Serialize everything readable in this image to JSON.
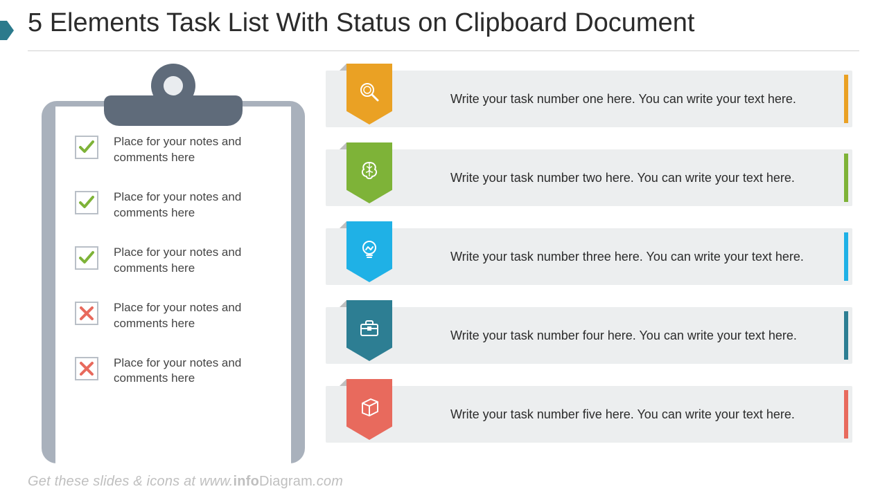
{
  "title": "5 Elements Task List With Status on Clipboard Document",
  "colors": {
    "orange": "#eaa124",
    "green": "#7eb338",
    "blue": "#1fb1e6",
    "teal": "#2d7e93",
    "red": "#e86a5d",
    "check_ok": "#7eb338",
    "check_no": "#e86a5d"
  },
  "clipboard": {
    "items": [
      {
        "status": "ok",
        "text": "Place for your notes and comments  here"
      },
      {
        "status": "ok",
        "text": "Place for your notes and comments  here"
      },
      {
        "status": "ok",
        "text": "Place for your notes and comments  here"
      },
      {
        "status": "no",
        "text": "Place for your notes and comments  here"
      },
      {
        "status": "no",
        "text": "Place for your notes and comments  here"
      }
    ]
  },
  "tasks": [
    {
      "icon": "magnifier-icon",
      "color": "orange",
      "text": "Write your task number one here. You can write your text here."
    },
    {
      "icon": "brain-icon",
      "color": "green",
      "text": "Write your task number two here. You can write your text here."
    },
    {
      "icon": "bulb-icon",
      "color": "blue",
      "text": "Write your task number three here. You can write your text here."
    },
    {
      "icon": "briefcase-icon",
      "color": "teal",
      "text": "Write your task number four here. You can write your text here."
    },
    {
      "icon": "cube-icon",
      "color": "red",
      "text": "Write your task number five here. You can write your text here."
    }
  ],
  "footer": {
    "before": "Get these slides & icons at www.",
    "brand_bold": "info",
    "brand_rest": "Diagram",
    "after": ".com"
  }
}
